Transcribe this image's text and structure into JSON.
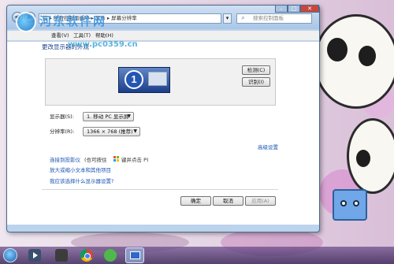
{
  "window": {
    "address_text": "控 ▸ 所有控制面板项 ▸ 显示 ▸ 屏幕分辨率",
    "search_placeholder": "搜索控制面板"
  },
  "menu": [
    "查看(V)",
    "工具(T)",
    "帮助(H)"
  ],
  "watermark": {
    "title": "河东软件网",
    "url": "www.pc0359.cn"
  },
  "heading": "更改显示器的外观",
  "preview": {
    "monitor_number": "1",
    "detect_label": "检测(C)",
    "identify_label": "识别(I)"
  },
  "settings": {
    "display_label": "显示器(S):",
    "display_value": "1. 移动 PC 显示屏",
    "resolution_label": "分辨率(R):",
    "resolution_value": "1366 × 768 (推荐)",
    "advanced_link": "高级设置"
  },
  "links": {
    "projector": "连接到投影仪",
    "projector_hint_pre": "(也可按住",
    "projector_hint_post": "键并点击 P)",
    "text_size": "放大或缩小文本和其他项目",
    "help": "我应该选择什么显示器设置?"
  },
  "buttons": {
    "ok": "确定",
    "cancel": "取消",
    "apply": "应用(A)"
  },
  "colors": {
    "link": "#1a54b3",
    "heading": "#1e3f8a",
    "close_button": "#c9463d"
  }
}
